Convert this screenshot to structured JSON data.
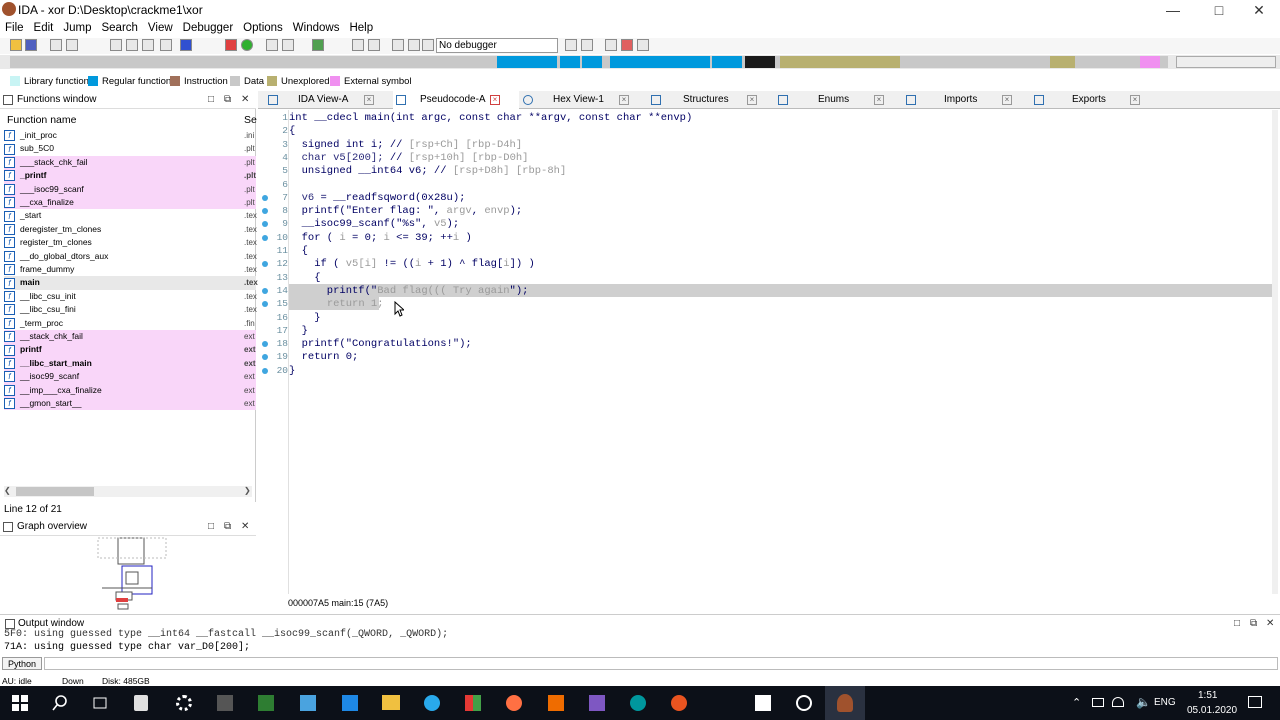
{
  "window": {
    "title": "IDA - xor D:\\Desktop\\crackme1\\xor"
  },
  "menu": [
    "File",
    "Edit",
    "Jump",
    "Search",
    "View",
    "Debugger",
    "Options",
    "Windows",
    "Help"
  ],
  "debugger_select": "No debugger",
  "legend": [
    {
      "label": "Library function",
      "color": "#c8f4f4"
    },
    {
      "label": "Regular function",
      "color": "#0099dd"
    },
    {
      "label": "Instruction",
      "color": "#a0705a"
    },
    {
      "label": "Data",
      "color": "#c8c8c8"
    },
    {
      "label": "Unexplored",
      "color": "#b8b070"
    },
    {
      "label": "External symbol",
      "color": "#f090f0"
    }
  ],
  "functions_window": {
    "title": "Functions window",
    "col_name": "Function name",
    "col_seg": "Se",
    "items": [
      {
        "name": "_init_proc",
        "seg": ".ini",
        "pink": false,
        "bold": false
      },
      {
        "name": "sub_5C0",
        "seg": ".plt",
        "pink": false,
        "bold": false
      },
      {
        "name": "___stack_chk_fail",
        "seg": ".plt",
        "pink": true,
        "bold": false
      },
      {
        "name": "_printf",
        "seg": ".plt",
        "pink": true,
        "bold": true
      },
      {
        "name": "___isoc99_scanf",
        "seg": ".plt",
        "pink": true,
        "bold": false
      },
      {
        "name": "__cxa_finalize",
        "seg": ".plt",
        "pink": true,
        "bold": false
      },
      {
        "name": "_start",
        "seg": ".tex",
        "pink": false,
        "bold": false
      },
      {
        "name": "deregister_tm_clones",
        "seg": ".tex",
        "pink": false,
        "bold": false
      },
      {
        "name": "register_tm_clones",
        "seg": ".tex",
        "pink": false,
        "bold": false
      },
      {
        "name": "__do_global_dtors_aux",
        "seg": ".tex",
        "pink": false,
        "bold": false
      },
      {
        "name": "frame_dummy",
        "seg": ".tex",
        "pink": false,
        "bold": false
      },
      {
        "name": "main",
        "seg": ".tex",
        "pink": false,
        "bold": true,
        "selected": true
      },
      {
        "name": "__libc_csu_init",
        "seg": ".tex",
        "pink": false,
        "bold": false
      },
      {
        "name": "__libc_csu_fini",
        "seg": ".tex",
        "pink": false,
        "bold": false
      },
      {
        "name": "_term_proc",
        "seg": ".fin",
        "pink": false,
        "bold": false
      },
      {
        "name": "__stack_chk_fail",
        "seg": "ext",
        "pink": true,
        "bold": false
      },
      {
        "name": "printf",
        "seg": "ext",
        "pink": true,
        "bold": true
      },
      {
        "name": "__libc_start_main",
        "seg": "ext",
        "pink": true,
        "bold": true
      },
      {
        "name": "__isoc99_scanf",
        "seg": "ext",
        "pink": true,
        "bold": false
      },
      {
        "name": "__imp___cxa_finalize",
        "seg": "ext",
        "pink": true,
        "bold": false
      },
      {
        "name": "__gmon_start__",
        "seg": "ext",
        "pink": true,
        "bold": false
      }
    ],
    "status": "Line 12 of 21"
  },
  "graph_overview": {
    "title": "Graph overview"
  },
  "tabs": [
    "IDA View-A",
    "Pseudocode-A",
    "Hex View-1",
    "Structures",
    "Enums",
    "Imports",
    "Exports"
  ],
  "code_lines": [
    {
      "n": "1",
      "html": "int __cdecl main(int argc, const char **argv, const char **envp)",
      "dot": false
    },
    {
      "n": "2",
      "html": "{",
      "dot": false
    },
    {
      "n": "3",
      "html": "  signed int i; // <span class='g'>[rsp+Ch] [rbp-D4h]</span>",
      "dot": false
    },
    {
      "n": "4",
      "html": "  <span class='n'>char v5[200];</span> // <span class='g'>[rsp+10h] [rbp-D0h]</span>",
      "dot": false
    },
    {
      "n": "5",
      "html": "  unsigned __int64 v6; // <span class='g'>[rsp+D8h] [rbp-8h]</span>",
      "dot": false
    },
    {
      "n": "6",
      "html": "",
      "dot": false
    },
    {
      "n": "7",
      "html": "  <span class='n'>v6</span> = __readfsqword(0x28u);",
      "dot": true
    },
    {
      "n": "8",
      "html": "  printf(\"Enter flag: \", <span class='g'>argv</span>, <span class='g'>envp</span>);",
      "dot": true
    },
    {
      "n": "9",
      "html": "  __isoc99_scanf(\"%s\", <span class='g'>v5</span>);",
      "dot": true
    },
    {
      "n": "10",
      "html": "  for ( <span class='g'>i</span> = 0; <span class='g'>i</span> &lt;= 39; ++<span class='g'>i</span> )",
      "dot": true
    },
    {
      "n": "11",
      "html": "  {",
      "dot": false
    },
    {
      "n": "12",
      "html": "    if ( <span class='g'>v5[i]</span> != ((<span class='g'>i</span> + 1) ^ flag[<span class='g'>i</span>]) )",
      "dot": true
    },
    {
      "n": "13",
      "html": "    {",
      "dot": false
    },
    {
      "n": "14",
      "html": "      printf(\"<span class='g'>Bad flag((( Try again</span>\");",
      "dot": true,
      "hl": true
    },
    {
      "n": "15",
      "html": "      <span class='g'>return 1;</span>",
      "dot": true,
      "hl": true
    },
    {
      "n": "16",
      "html": "    }",
      "dot": false
    },
    {
      "n": "17",
      "html": "  }",
      "dot": false
    },
    {
      "n": "18",
      "html": "  printf(\"Congratulations!\");",
      "dot": true
    },
    {
      "n": "19",
      "html": "  return 0;",
      "dot": true
    },
    {
      "n": "20",
      "html": "}",
      "dot": true
    }
  ],
  "addr_status": "000007A5 main:15 (7A5)",
  "output_window": {
    "title": "Output window",
    "line1": "5F0: using guessed type __int64 __fastcall __isoc99_scanf(_QWORD, _QWORD);",
    "line2": "71A: using guessed type char var_D0[200];"
  },
  "python_btn": "Python",
  "status": {
    "state": "AU:  idle",
    "dir": "Down",
    "disk": "Disk: 485GB"
  },
  "tray": {
    "lang": "ENG",
    "time": "1:51",
    "date": "05.01.2020"
  }
}
